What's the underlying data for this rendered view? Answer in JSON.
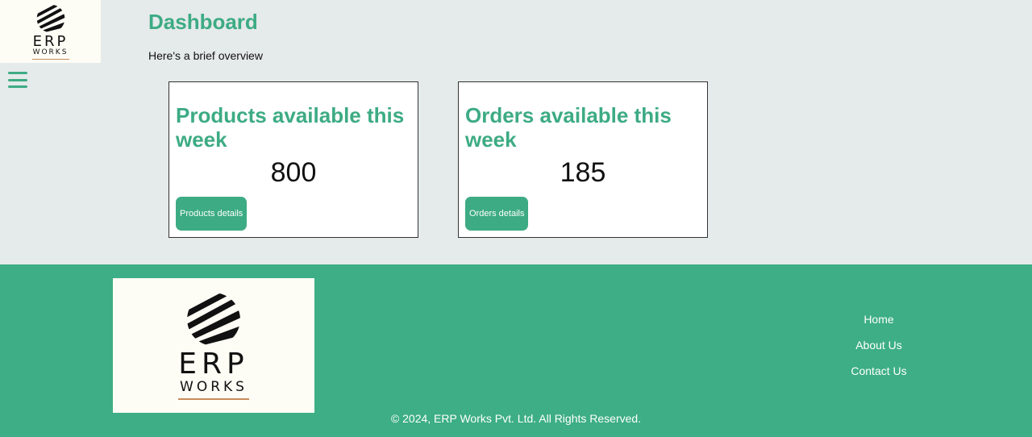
{
  "logo": {
    "line1": "ERP",
    "line2": "WORKS",
    "accent_color": "#c98a5a"
  },
  "menu_icon": "hamburger-menu-icon",
  "header": {
    "title": "Dashboard",
    "subtitle": "Here's a brief overview"
  },
  "cards": [
    {
      "title": "Products available this week",
      "value": "800",
      "button_label": "Products details"
    },
    {
      "title": "Orders available this week",
      "value": "185",
      "button_label": "Orders details"
    }
  ],
  "footer": {
    "links": [
      "Home",
      "About Us",
      "Contact Us"
    ],
    "copyright": "© 2024, ERP Works Pvt. Ltd. All Rights Reserved."
  },
  "colors": {
    "brand": "#3dab84",
    "background": "#e5eaea",
    "logo_bg": "#fdfcf5"
  }
}
